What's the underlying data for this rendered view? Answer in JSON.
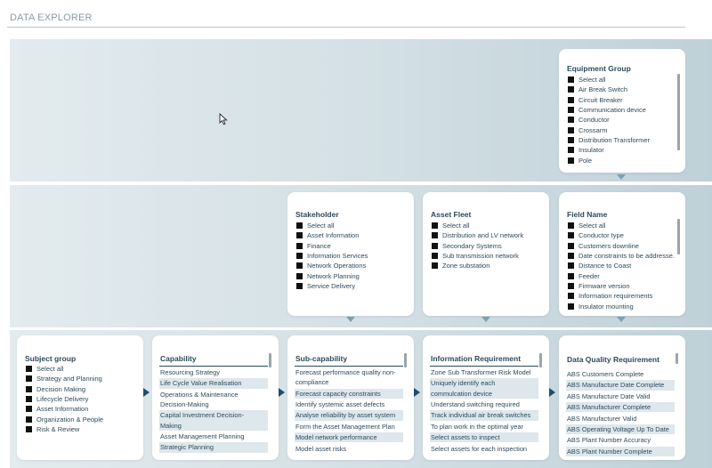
{
  "header": {
    "title": "DATA EXPLORER"
  },
  "equipment_group": {
    "title": "Equipment Group",
    "items": [
      "Select all",
      "Air Break Switch",
      "Circuit Breaker",
      "Communication device",
      "Conductor",
      "Crossarm",
      "Distribution Transformer",
      "Insulator",
      "Pole"
    ]
  },
  "stakeholder": {
    "title": "Stakeholder",
    "items": [
      "Select all",
      "Asset Information",
      "Finance",
      "Information Services",
      "Network Operations",
      "Network Planning",
      "Service Delivery"
    ]
  },
  "asset_fleet": {
    "title": "Asset Fleet",
    "items": [
      "Select all",
      "Distribution and LV network",
      "Secondary Systems",
      "Sub transmission network",
      "Zone substation"
    ]
  },
  "field_name": {
    "title": "Field Name",
    "items": [
      "Select all",
      "Conductor type",
      "Customers downline",
      "Date constraints to be addresse...",
      "Distance to Coast",
      "Feeder",
      "Firmware version",
      "Information requirements",
      "Insulator mounting"
    ]
  },
  "subject_group": {
    "title": "Subject group",
    "items": [
      "Select all",
      "Strategy and Planning",
      "Decision Making",
      "Lifecycle Delivery",
      "Asset Information",
      "Organization & People",
      "Risk & Review"
    ]
  },
  "capability": {
    "title": "Capability",
    "rows": [
      "Resourcing Strategy",
      "Life Cycle Value Realisation",
      "Operations & Maintenance",
      "Decision-Making",
      "Capital Investment Decision-",
      "Making",
      "Asset Management Planning",
      "Strategic Planning"
    ]
  },
  "sub_capability": {
    "title": "Sub-capability",
    "rows": [
      "Forecast performance quality non-",
      "compliance",
      "Forecast capacity constraints",
      "Identify systemic asset defects",
      "Analyse reliability by asset system",
      "Form the Asset Management Plan",
      "Model network performance",
      "Model asset risks"
    ]
  },
  "information_requirement": {
    "title": "Information Requirement",
    "rows": [
      "Zone Sub Transformer Risk Model",
      "Uniquely identify each",
      "commulcation device",
      "Understand switching required",
      "Track individual air break switches",
      "To plan work in the optimal year",
      "Select assets to inspect",
      "Select assets for each inspection"
    ]
  },
  "data_quality_requirement": {
    "title": "Data Quality Requirement",
    "rows": [
      "ABS Customers Complete",
      "ABS Manufacture Date Complete",
      "ABS Manufacture Date Valid",
      "ABS Manufacturer Complete",
      "ABS Manufacturer Valid",
      "ABS Operating Voltage Up To Date",
      "ABS Plant Number Accuracy",
      "ABS Plant Number Complete"
    ]
  }
}
